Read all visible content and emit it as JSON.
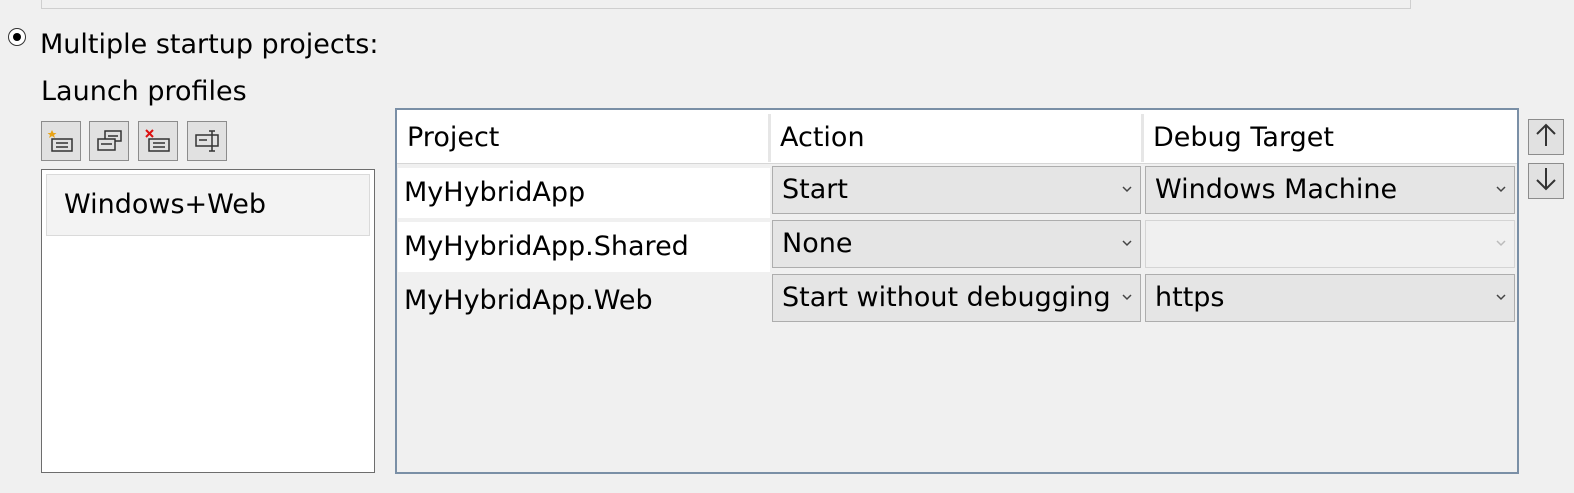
{
  "startup": {
    "multiple_label": "Multiple startup projects:",
    "launch_profiles_label": "Launch profiles"
  },
  "toolbar": {
    "buttons": [
      {
        "name": "new-profile-icon"
      },
      {
        "name": "copy-profile-icon"
      },
      {
        "name": "delete-profile-icon"
      },
      {
        "name": "rename-profile-icon"
      }
    ]
  },
  "profiles": {
    "items": [
      "Windows+Web"
    ],
    "selected": "Windows+Web"
  },
  "grid": {
    "columns": [
      "Project",
      "Action",
      "Debug Target"
    ],
    "rows": [
      {
        "project": "MyHybridApp",
        "action": "Start",
        "target": "Windows Machine",
        "target_enabled": true
      },
      {
        "project": "MyHybridApp.Shared",
        "action": "None",
        "target": "",
        "target_enabled": false
      },
      {
        "project": "MyHybridApp.Web",
        "action": "Start without debugging",
        "target": "https",
        "target_enabled": true
      }
    ]
  },
  "reorder": {
    "up_icon": "arrow-up-icon",
    "down_icon": "arrow-down-icon"
  }
}
